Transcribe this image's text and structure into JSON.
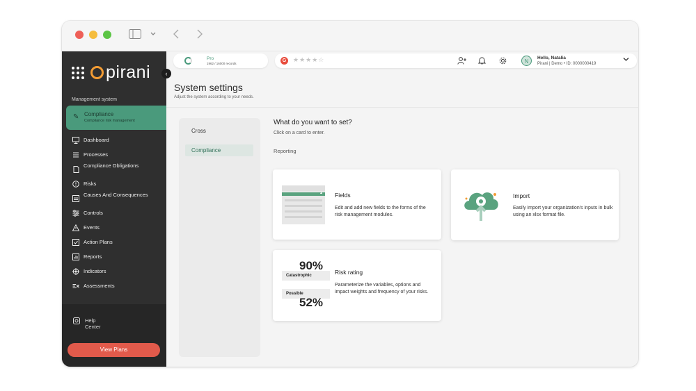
{
  "sidebar": {
    "logo_text": "pirani",
    "section_label": "Management system",
    "active": {
      "title": "Compliance",
      "subtitle": "Compliance risk management"
    },
    "items": [
      {
        "label": "Dashboard",
        "icon": "monitor-icon"
      },
      {
        "label": "Processes",
        "icon": "processes-icon"
      },
      {
        "label": "Compliance Obligations",
        "icon": "obligations-icon"
      },
      {
        "label": "Risks",
        "icon": "alert-circle-icon"
      },
      {
        "label": "Causes And Consequences",
        "icon": "causes-icon"
      },
      {
        "label": "Controls",
        "icon": "sliders-icon"
      },
      {
        "label": "Events",
        "icon": "warning-triangle-icon"
      },
      {
        "label": "Action Plans",
        "icon": "checkbox-icon"
      },
      {
        "label": "Reports",
        "icon": "chart-icon"
      },
      {
        "label": "Indicators",
        "icon": "target-icon"
      },
      {
        "label": "Assessments",
        "icon": "assessments-icon"
      }
    ],
    "help_label": "Help Center",
    "view_plans_label": "View Plans"
  },
  "topbar": {
    "plan_name": "Pro",
    "plan_records": "1962 / 16000 records",
    "g2_label": "G",
    "user_greeting": "Hello, Natalia",
    "user_info": "Pirani | Demo • ID: 0000000419",
    "avatar_letter": "N"
  },
  "page": {
    "title": "System settings",
    "subtitle": "Adjust the system according to your needs.",
    "left_menu": [
      "Cross",
      "Compliance"
    ],
    "question": "What do you want to set?",
    "hint": "Click on a card to enter.",
    "category": "Reporting"
  },
  "cards": {
    "fields": {
      "title": "Fields",
      "description": "Edit and add new fields to the forms of the risk management modules."
    },
    "import": {
      "title": "Import",
      "description": "Easily import your organization's inputs in bulk using an xlsx format file."
    },
    "risk_rating": {
      "title": "Risk rating",
      "description": "Parameterize the variables, options and impact weights and frequency of your risks.",
      "value_1": "90%",
      "label_1": "Catastrophic",
      "label_2": "Possible",
      "value_2": "52%"
    }
  },
  "colors": {
    "accent": "#4a9a7c",
    "sidebar": "#2f2f2f",
    "view_plans": "#e15a4b",
    "logo_orange": "#f39c34"
  }
}
